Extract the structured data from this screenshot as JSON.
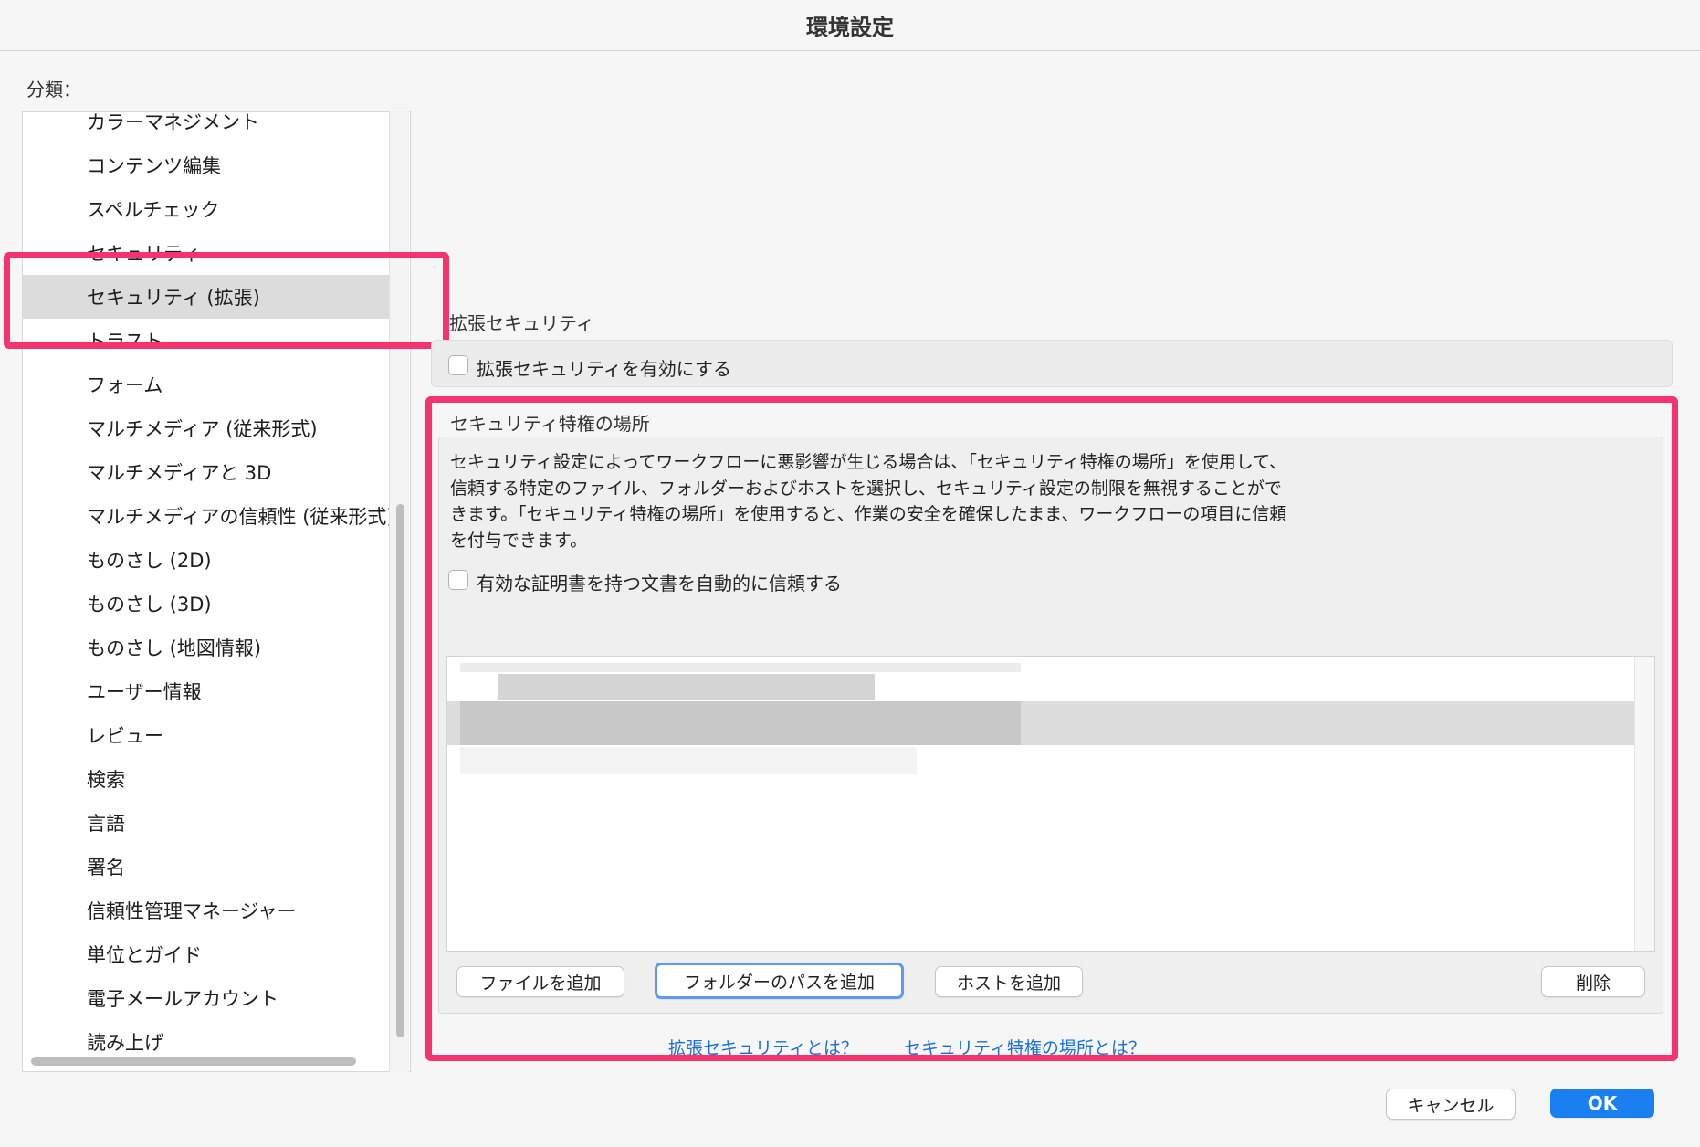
{
  "window": {
    "title": "環境設定"
  },
  "sidebar": {
    "label": "分類：",
    "items": [
      {
        "label": "カラーマネジメント"
      },
      {
        "label": "コンテンツ編集"
      },
      {
        "label": "スペルチェック"
      },
      {
        "label": "セキュリティ"
      },
      {
        "label": "セキュリティ (拡張)",
        "selected": true
      },
      {
        "label": "トラスト"
      },
      {
        "label": "フォーム"
      },
      {
        "label": "マルチメディア (従来形式)"
      },
      {
        "label": "マルチメディアと 3D"
      },
      {
        "label": "マルチメディアの信頼性 (従来形式)"
      },
      {
        "label": "ものさし (2D)"
      },
      {
        "label": "ものさし (3D)"
      },
      {
        "label": "ものさし (地図情報)"
      },
      {
        "label": "ユーザー情報"
      },
      {
        "label": "レビュー"
      },
      {
        "label": "検索"
      },
      {
        "label": "言語"
      },
      {
        "label": "署名"
      },
      {
        "label": "信頼性管理マネージャー"
      },
      {
        "label": "単位とガイド"
      },
      {
        "label": "電子メールアカウント"
      },
      {
        "label": "読み上げ"
      }
    ]
  },
  "enhanced_security": {
    "title": "拡張セキュリティ",
    "enable_label": "拡張セキュリティを有効にする",
    "enable_checked": false
  },
  "privileged_locations": {
    "title": "セキュリティ特権の場所",
    "description_lines": [
      "セキュリティ設定によってワークフローに悪影響が生じる場合は、「セキュリティ特権の場所」を使用して、",
      "信頼する特定のファイル、フォルダーおよびホストを選択し、セキュリティ設定の制限を無視することがで",
      "きます。「セキュリティ特権の場所」を使用すると、作業の安全を確保したまま、ワークフローの項目に信頼",
      "を付与できます。"
    ],
    "auto_trust_label": "有効な証明書を持つ文書を自動的に信頼する",
    "auto_trust_checked": false,
    "buttons": {
      "add_file": "ファイルを追加",
      "add_folder": "フォルダーのパスを追加",
      "add_host": "ホストを追加",
      "delete": "削除"
    }
  },
  "links": {
    "what_is_enhanced": "拡張セキュリティとは？",
    "what_is_privileged": "セキュリティ特権の場所とは？"
  },
  "footer": {
    "cancel": "キャンセル",
    "ok": "OK"
  },
  "colors": {
    "highlight": "#f5336e",
    "accent": "#1a7ff0",
    "link": "#1a6fd8"
  }
}
